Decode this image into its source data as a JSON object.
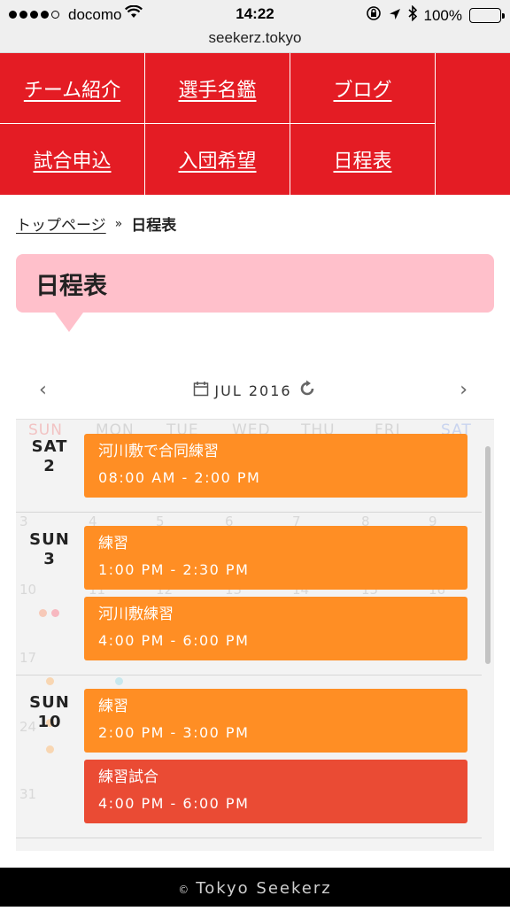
{
  "status_bar": {
    "carrier": "docomo",
    "time": "14:22",
    "battery_percent": "100%",
    "battery_color": "#4cd964",
    "icons": [
      "signal-dots-icon",
      "wifi-icon",
      "rotation-lock-icon",
      "location-arrow-icon",
      "bluetooth-icon",
      "battery-icon"
    ]
  },
  "browser": {
    "url": "seekerz.tokyo"
  },
  "nav": {
    "background": "#e41c24",
    "items": [
      {
        "label": "チーム紹介"
      },
      {
        "label": "選手名鑑"
      },
      {
        "label": "ブログ"
      },
      {
        "label": "試合申込"
      },
      {
        "label": "入団希望"
      },
      {
        "label": "日程表"
      }
    ]
  },
  "breadcrumb": {
    "home": "トップページ",
    "separator": "»",
    "current": "日程表"
  },
  "page_title": "日程表",
  "calendar": {
    "prev": "‹",
    "next": "›",
    "month": "JUL 2016",
    "weekdays": [
      "SUN",
      "MON",
      "TUE",
      "WED",
      "THU",
      "FRI",
      "SAT"
    ],
    "background_dates": [
      "3",
      "4",
      "5",
      "6",
      "7",
      "8",
      "9",
      "10",
      "11",
      "12",
      "13",
      "14",
      "15",
      "16",
      "17",
      "24",
      "31"
    ],
    "days": [
      {
        "weekday": "SAT",
        "date": "2",
        "events": [
          {
            "title": "河川敷で合同練習",
            "time": "08:00 AM - 2:00 PM",
            "color": "#ff8e24"
          }
        ]
      },
      {
        "weekday": "SUN",
        "date": "3",
        "events": [
          {
            "title": "練習",
            "time": "1:00 PM - 2:30 PM",
            "color": "#ff8e24"
          },
          {
            "title": "河川敷練習",
            "time": "4:00 PM - 6:00 PM",
            "color": "#ff8e24"
          }
        ]
      },
      {
        "weekday": "SUN",
        "date": "10",
        "events": [
          {
            "title": "練習",
            "time": "2:00 PM - 3:00 PM",
            "color": "#ff8e24"
          },
          {
            "title": "練習試合",
            "time": "4:00 PM - 6:00 PM",
            "color": "#ea4b34"
          }
        ]
      }
    ]
  },
  "footer": {
    "copyright_symbol": "©",
    "text": "Tokyo Seekerz"
  }
}
